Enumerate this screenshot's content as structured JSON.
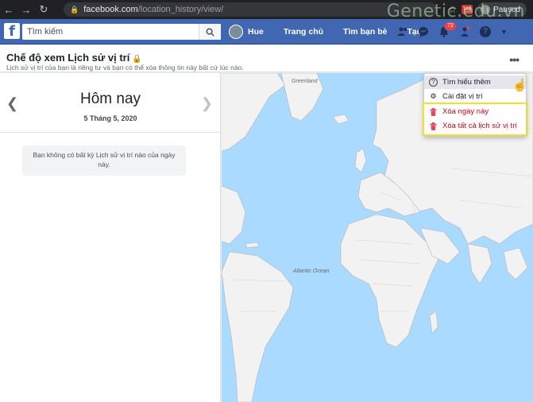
{
  "browser": {
    "url_domain": "facebook.com",
    "url_path": "/location_history/view/",
    "profile_status": "Paused",
    "extension_label": "TAB",
    "watermark": "Genetic.edu.vn"
  },
  "fb_header": {
    "search_placeholder": "Tìm kiếm",
    "user_name": "Hue",
    "nav_home": "Trang chủ",
    "nav_find_friends": "Tìm bạn bè",
    "nav_create": "Tạo",
    "notification_count": "72"
  },
  "page": {
    "title": "Chế độ xem Lịch sử vị trí",
    "subtitle": "Lịch sử vị trí của bạn là riêng tư và bạn có thể xóa thông tin này bất cứ lúc nào.",
    "more_label": "•••"
  },
  "left_panel": {
    "day_label": "Hôm nay",
    "date_label": "5 Tháng 5, 2020",
    "empty_message": "Bạn không có bất kỳ Lịch sử vị trí nào của ngày này."
  },
  "map": {
    "labels": {
      "greenland": "Greenland",
      "atlantic": "Atlantic Ocean"
    },
    "colors": {
      "water": "#aadaff",
      "land": "#f2f2f2",
      "border": "#9b9b9b"
    }
  },
  "dropdown": {
    "items": [
      {
        "label": "Tìm hiểu thêm",
        "icon": "question-icon"
      },
      {
        "label": "Cài đặt vị trí",
        "icon": "gear-icon"
      },
      {
        "label": "Xóa ngày này",
        "icon": "trash-icon"
      },
      {
        "label": "Xóa tất cả lịch sử vị trí",
        "icon": "trash-icon"
      }
    ],
    "highlight_color": "#f5e12d",
    "danger_color": "#d0021b"
  }
}
